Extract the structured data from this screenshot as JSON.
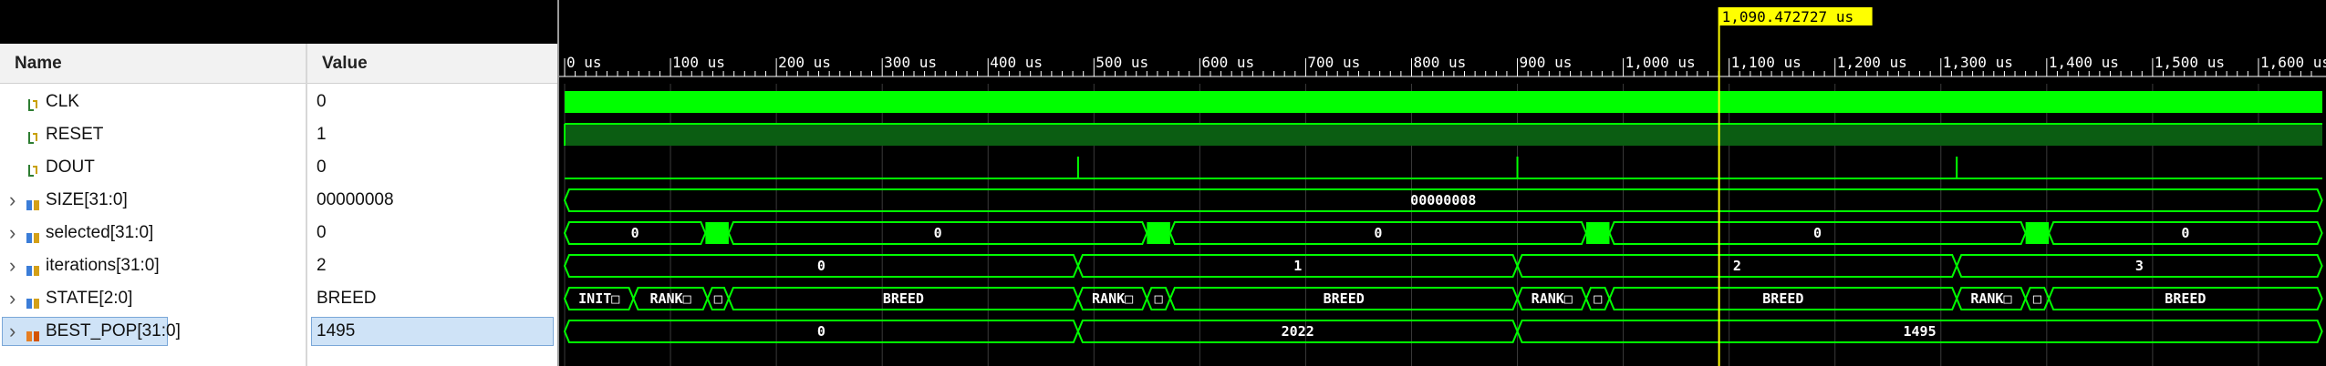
{
  "columns": {
    "name": "Name",
    "value": "Value"
  },
  "cursor_label": "1,090.472727 us",
  "cursor_time": 1090.472727,
  "time_axis": {
    "start": 0,
    "end": 1650,
    "major_step": 100,
    "ticks": [
      "0 us",
      "100 us",
      "200 us",
      "300 us",
      "400 us",
      "500 us",
      "600 us",
      "700 us",
      "800 us",
      "900 us",
      "1,000 us",
      "1,100 us",
      "1,200 us",
      "1,300 us",
      "1,400 us",
      "1,500 us",
      "1,600 us"
    ]
  },
  "colors": {
    "wave": "#00ff00",
    "cursor": "#ffff00",
    "background": "#000000"
  },
  "signals": [
    {
      "name": "CLK",
      "value": "0",
      "icon": "bit-signal-icon",
      "kind": "clock"
    },
    {
      "name": "RESET",
      "value": "1",
      "icon": "bit-signal-icon",
      "kind": "high"
    },
    {
      "name": "DOUT",
      "value": "0",
      "icon": "bit-signal-icon",
      "kind": "pulses",
      "pulses": [
        485,
        900,
        1315
      ]
    },
    {
      "name": "SIZE[31:0]",
      "value": "00000008",
      "icon": "bus-signal-icon",
      "kind": "bus",
      "segments": [
        {
          "start": 0,
          "end": 1660,
          "label": "00000008"
        }
      ]
    },
    {
      "name": "selected[31:0]",
      "value": "0",
      "icon": "bus-signal-icon",
      "kind": "bus",
      "segments": [
        {
          "start": 0,
          "end": 133,
          "label": "0"
        },
        {
          "start": 133,
          "end": 155,
          "label": "",
          "dense": true
        },
        {
          "start": 155,
          "end": 550,
          "label": "0"
        },
        {
          "start": 550,
          "end": 572,
          "label": "",
          "dense": true
        },
        {
          "start": 572,
          "end": 965,
          "label": "0"
        },
        {
          "start": 965,
          "end": 987,
          "label": "",
          "dense": true
        },
        {
          "start": 987,
          "end": 1380,
          "label": "0"
        },
        {
          "start": 1380,
          "end": 1402,
          "label": "",
          "dense": true
        },
        {
          "start": 1402,
          "end": 1660,
          "label": "0"
        }
      ]
    },
    {
      "name": "iterations[31:0]",
      "value": "2",
      "icon": "bus-signal-icon",
      "kind": "bus",
      "segments": [
        {
          "start": 0,
          "end": 485,
          "label": "0"
        },
        {
          "start": 485,
          "end": 900,
          "label": "1"
        },
        {
          "start": 900,
          "end": 1315,
          "label": "2"
        },
        {
          "start": 1315,
          "end": 1660,
          "label": "3"
        }
      ]
    },
    {
      "name": "STATE[2:0]",
      "value": "BREED",
      "icon": "bus-signal-icon",
      "kind": "bus",
      "segments": [
        {
          "start": 0,
          "end": 65,
          "label": "INIT□"
        },
        {
          "start": 65,
          "end": 135,
          "label": "RANK□"
        },
        {
          "start": 135,
          "end": 155,
          "label": "□"
        },
        {
          "start": 155,
          "end": 485,
          "label": "BREED"
        },
        {
          "start": 485,
          "end": 550,
          "label": "RANK□"
        },
        {
          "start": 550,
          "end": 572,
          "label": "□"
        },
        {
          "start": 572,
          "end": 900,
          "label": "BREED"
        },
        {
          "start": 900,
          "end": 965,
          "label": "RANK□"
        },
        {
          "start": 965,
          "end": 987,
          "label": "□"
        },
        {
          "start": 987,
          "end": 1315,
          "label": "BREED"
        },
        {
          "start": 1315,
          "end": 1380,
          "label": "RANK□"
        },
        {
          "start": 1380,
          "end": 1402,
          "label": "□"
        },
        {
          "start": 1402,
          "end": 1660,
          "label": "BREED"
        }
      ]
    },
    {
      "name": "BEST_POP[31:0]",
      "value": "1495",
      "icon": "bus-signal-icon",
      "kind": "bus",
      "selected": true,
      "segments": [
        {
          "start": 0,
          "end": 485,
          "label": "0"
        },
        {
          "start": 485,
          "end": 900,
          "label": "2022"
        },
        {
          "start": 900,
          "end": 1660,
          "label": "1495"
        }
      ]
    }
  ]
}
